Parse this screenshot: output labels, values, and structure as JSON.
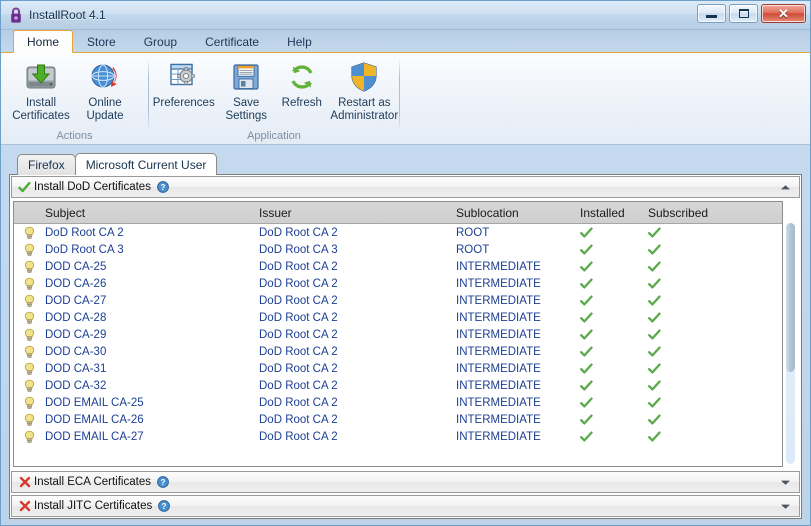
{
  "window": {
    "title": "InstallRoot 4.1",
    "app_icon": "padlock-icon",
    "minimize_label": "Minimize",
    "maximize_label": "Maximize",
    "close_label": "Close",
    "close_glyph": "✕"
  },
  "ribbon": {
    "tabs": [
      {
        "label": "Home",
        "active": true
      },
      {
        "label": "Store",
        "active": false
      },
      {
        "label": "Group",
        "active": false
      },
      {
        "label": "Certificate",
        "active": false
      },
      {
        "label": "Help",
        "active": false
      }
    ],
    "groups": [
      {
        "label": "Actions",
        "buttons": [
          {
            "label": "Install\nCertificates",
            "icon": "hard-drive-download-icon"
          },
          {
            "label": "Online\nUpdate",
            "icon": "globe-refresh-icon"
          }
        ]
      },
      {
        "label": "Application",
        "buttons": [
          {
            "label": "Preferences",
            "icon": "table-gear-icon"
          },
          {
            "label": "Save\nSettings",
            "icon": "floppy-disk-icon"
          },
          {
            "label": "Refresh",
            "icon": "refresh-arrows-icon"
          },
          {
            "label": "Restart as\nAdministrator",
            "icon": "uac-shield-icon"
          }
        ]
      }
    ]
  },
  "store_tabs": [
    {
      "label": "Firefox",
      "active": false
    },
    {
      "label": "Microsoft Current User",
      "active": true
    }
  ],
  "panels": [
    {
      "title": "Install DoD Certificates",
      "status": "check",
      "expanded": true,
      "chevron": "up",
      "help_icon": "help-icon"
    },
    {
      "title": "Install ECA Certificates",
      "status": "cross",
      "expanded": false,
      "chevron": "down",
      "help_icon": "help-icon"
    },
    {
      "title": "Install JITC Certificates",
      "status": "cross",
      "expanded": false,
      "chevron": "down",
      "help_icon": "help-icon"
    }
  ],
  "grid": {
    "columns": [
      "Subject",
      "Issuer",
      "Sublocation",
      "Installed",
      "Subscribed"
    ],
    "rows": [
      {
        "subject": "DoD Root CA 2",
        "issuer": "DoD Root CA 2",
        "sublocation": "ROOT",
        "installed": true,
        "subscribed": true
      },
      {
        "subject": "DoD Root CA 3",
        "issuer": "DoD Root CA 3",
        "sublocation": "ROOT",
        "installed": true,
        "subscribed": true
      },
      {
        "subject": "DOD CA-25",
        "issuer": "DoD Root CA 2",
        "sublocation": "INTERMEDIATE",
        "installed": true,
        "subscribed": true
      },
      {
        "subject": "DOD CA-26",
        "issuer": "DoD Root CA 2",
        "sublocation": "INTERMEDIATE",
        "installed": true,
        "subscribed": true
      },
      {
        "subject": "DOD CA-27",
        "issuer": "DoD Root CA 2",
        "sublocation": "INTERMEDIATE",
        "installed": true,
        "subscribed": true
      },
      {
        "subject": "DOD CA-28",
        "issuer": "DoD Root CA 2",
        "sublocation": "INTERMEDIATE",
        "installed": true,
        "subscribed": true
      },
      {
        "subject": "DOD CA-29",
        "issuer": "DoD Root CA 2",
        "sublocation": "INTERMEDIATE",
        "installed": true,
        "subscribed": true
      },
      {
        "subject": "DOD CA-30",
        "issuer": "DoD Root CA 2",
        "sublocation": "INTERMEDIATE",
        "installed": true,
        "subscribed": true
      },
      {
        "subject": "DOD CA-31",
        "issuer": "DoD Root CA 2",
        "sublocation": "INTERMEDIATE",
        "installed": true,
        "subscribed": true
      },
      {
        "subject": "DOD CA-32",
        "issuer": "DoD Root CA 2",
        "sublocation": "INTERMEDIATE",
        "installed": true,
        "subscribed": true
      },
      {
        "subject": "DOD EMAIL CA-25",
        "issuer": "DoD Root CA 2",
        "sublocation": "INTERMEDIATE",
        "installed": true,
        "subscribed": true
      },
      {
        "subject": "DOD EMAIL CA-26",
        "issuer": "DoD Root CA 2",
        "sublocation": "INTERMEDIATE",
        "installed": true,
        "subscribed": true
      },
      {
        "subject": "DOD EMAIL CA-27",
        "issuer": "DoD Root CA 2",
        "sublocation": "INTERMEDIATE",
        "installed": true,
        "subscribed": true
      }
    ],
    "row_icon": "certificate-bulb-icon",
    "check_icon": "green-check-icon",
    "scrollbar": "vertical-scrollbar"
  },
  "colors": {
    "accent_orange": "#e5a33a",
    "link_blue": "#1c3f94",
    "check_green": "#5aa94a",
    "cross_red": "#d63a2f",
    "title_blue": "#13304d"
  }
}
